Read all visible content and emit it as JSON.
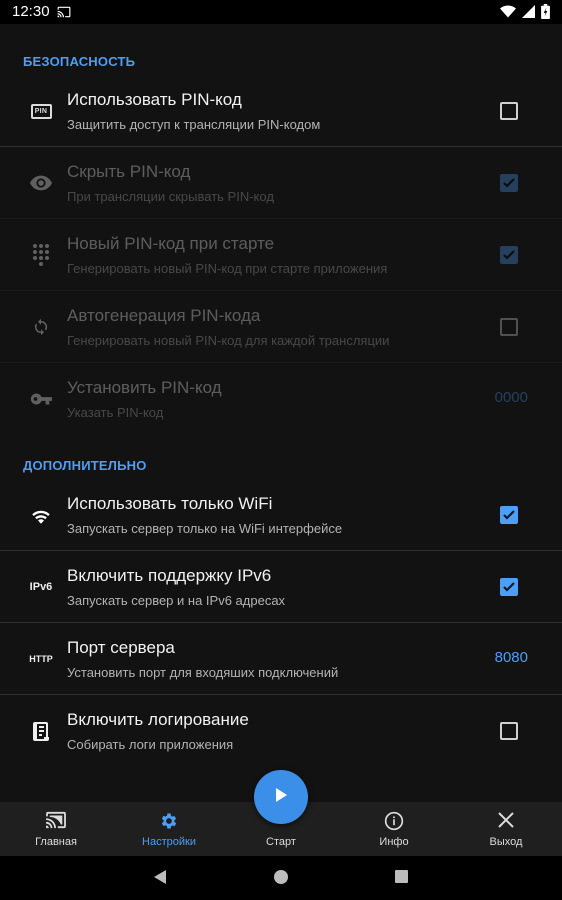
{
  "status_bar": {
    "time": "12:30",
    "icons": [
      "cast-icon",
      "wifi-icon",
      "signal-icon",
      "battery-icon"
    ]
  },
  "sections": {
    "security": "БЕЗОПАСНОСТЬ",
    "advanced": "ДОПОЛНИТЕЛЬНО"
  },
  "prefs": {
    "use_pin": {
      "title": "Использовать PIN-код",
      "summary": "Защитить доступ к трансляции PIN-кодом",
      "checked": false,
      "enabled": true,
      "icon": "pin-icon",
      "icon_text": "PIN"
    },
    "hide_pin": {
      "title": "Скрыть PIN-код",
      "summary": "При трансляции скрывать PIN-код",
      "checked": true,
      "enabled": false,
      "icon": "eye-icon"
    },
    "new_pin": {
      "title": "Новый PIN-код при старте",
      "summary": "Генерировать новый PIN-код при старте приложения",
      "checked": true,
      "enabled": false,
      "icon": "dialpad-icon"
    },
    "autogen_pin": {
      "title": "Автогенерация PIN-кода",
      "summary": "Генерировать новый PIN-код для каждой трансляции",
      "checked": false,
      "enabled": false,
      "icon": "sync-icon"
    },
    "set_pin": {
      "title": "Установить PIN-код",
      "summary": "Указать PIN-код",
      "value": "0000",
      "enabled": false,
      "icon": "key-icon"
    },
    "wifi_only": {
      "title": "Использовать только WiFi",
      "summary": "Запускать сервер только на WiFi интерфейсе",
      "checked": true,
      "enabled": true,
      "icon": "wifi-icon"
    },
    "ipv6": {
      "title": "Включить поддержку IPv6",
      "summary": "Запускать сервер и на IPv6 адресах",
      "checked": true,
      "enabled": true,
      "icon": "ipv6-icon",
      "icon_text": "IPv6"
    },
    "server_port": {
      "title": "Порт сервера",
      "summary": "Установить порт для входяших подключений",
      "value": "8080",
      "enabled": true,
      "icon": "http-icon",
      "icon_text": "HTTP"
    },
    "logging": {
      "title": "Включить логирование",
      "summary": "Собирать логи приложения",
      "checked": false,
      "enabled": true,
      "icon": "log-icon"
    }
  },
  "bottom_nav": {
    "items": [
      {
        "label": "Главная",
        "icon": "cast-icon",
        "active": false
      },
      {
        "label": "Настройки",
        "icon": "gear-icon",
        "active": true
      },
      {
        "label": "Старт",
        "icon": "play-icon",
        "active": false
      },
      {
        "label": "Инфо",
        "icon": "info-icon",
        "active": false
      },
      {
        "label": "Выход",
        "icon": "close-icon",
        "active": false
      }
    ]
  },
  "colors": {
    "accent": "#4d9ef5",
    "background": "#121212",
    "nav_background": "#1f1f1f",
    "fab": "#3c8fe8"
  }
}
